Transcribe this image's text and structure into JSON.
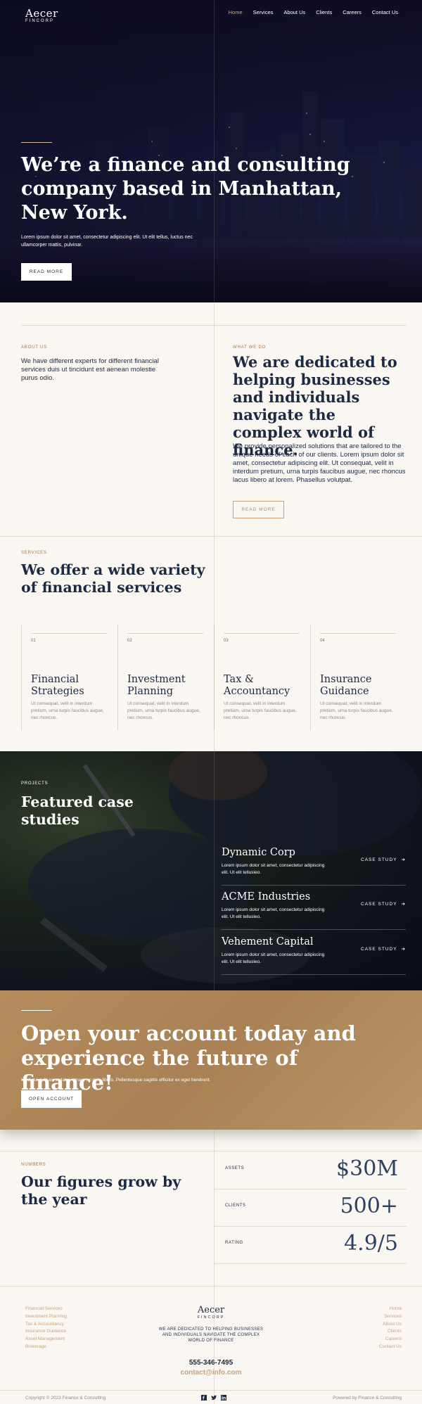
{
  "header": {
    "brand": "Aecer",
    "brand_sub": "FINCORP",
    "nav": [
      "Home",
      "Services",
      "About Us",
      "Clients",
      "Careers",
      "Contact Us"
    ]
  },
  "hero": {
    "title": "We’re a finance and consulting company based in Manhattan, New York.",
    "text": "Lorem ipsum dolor sit amet, consectetur adipiscing elit. Ut elit tellus, luctus nec ullamcorper mattis, pulvinar.",
    "button": "READ MORE"
  },
  "about": {
    "label": "ABOUT US",
    "text": "We have different experts for different financial services duis ut tincidunt est aenean molestie purus odio."
  },
  "what": {
    "label": "WHAT WE DO",
    "title": "We are dedicated to helping businesses and individuals navigate the complex world of finance.",
    "text": "We provide personalized solutions that are tailored to the unique needs of each of our clients. Lorem ipsum dolor sit amet, consectetur adipiscing elit. Ut consequat, velit in interdum pretium, urna turpis faucibus augue, nec rhoncus lacus libero at lorem. Phasellus volutpat.",
    "button": "READ MORE"
  },
  "services": {
    "label": "SERVICES",
    "title": "We offer a wide variety of financial services",
    "items": [
      {
        "num": "01",
        "title": "Financial Strategies",
        "desc": "Ut consequat, velit in interdum pretium, urna turpis faucibus augue, nec rhoncus."
      },
      {
        "num": "02",
        "title": "Investment Planning",
        "desc": "Ut consequat, velit in interdum pretium, urna turpis faucibus augue, nec rhoncus."
      },
      {
        "num": "03",
        "title": "Tax & Accountancy",
        "desc": "Ut consequat, velit in interdum pretium, urna turpis faucibus augue, nec rhoncus."
      },
      {
        "num": "04",
        "title": "Insurance Guidance",
        "desc": "Ut consequat, velit in interdum pretium, urna turpis faucibus augue, nec rhoncus."
      }
    ]
  },
  "projects": {
    "label": "PROJECTS",
    "title": "Featured case studies",
    "cases": [
      {
        "name": "Dynamic Corp",
        "desc": "Lorem ipsum dolor sit amet, consectetur adipiscing elit. Ut elit tellusleo.",
        "link": "CASE STUDY"
      },
      {
        "name": "ACME Industries",
        "desc": "Lorem ipsum dolor sit amet, consectetur adipiscing elit. Ut elit tellusleo.",
        "link": "CASE STUDY"
      },
      {
        "name": "Vehement Capital",
        "desc": "Lorem ipsum dolor sit amet, consectetur adipiscing elit. Ut elit tellusleo.",
        "link": "CASE STUDY"
      }
    ]
  },
  "cta": {
    "title": "Open your account today and experience the future of finance!",
    "text": "Ut id dui quis ex sodales ornare ac quis libero. Pellentesque sagittis efficitur ex eget hendrerit.",
    "button": "OPEN ACCOUNT"
  },
  "numbers": {
    "label": "NUMBERS",
    "title": "Our figures grow by the year",
    "stats": [
      {
        "key": "ASSETS",
        "value": "$30M"
      },
      {
        "key": "CLIENTS",
        "value": "500+"
      },
      {
        "key": "RATING",
        "value": "4.9/5"
      }
    ]
  },
  "footer": {
    "left_links": [
      "Financial Services",
      "Investment Planning",
      "Tax & Accountancy",
      "Insurance Guidance",
      "Asset Management",
      "Brokerage"
    ],
    "right_links": [
      "Home",
      "Services",
      "About Us",
      "Clients",
      "Careers",
      "Contact Us"
    ],
    "brand": "Aecer",
    "brand_sub": "FINCORP",
    "tagline": "WE ARE DEDICATED TO HELPING BUSINESSES AND INDIVIDUALS NAVIGATE THE COMPLEX WORLD OF FINANCE",
    "phone": "555-346-7495",
    "email": "contact@info.com",
    "copyright": "Copyright © 2023 Finance & Consulting",
    "powered": "Powered by Finance & Consulting",
    "social_icons": [
      "facebook-icon",
      "twitter-icon",
      "linkedin-icon"
    ]
  },
  "colors": {
    "accent": "#c9a27c",
    "navy": "#1d2a44",
    "cta_bg": "#b08658",
    "page_bg": "#faf6f1"
  }
}
